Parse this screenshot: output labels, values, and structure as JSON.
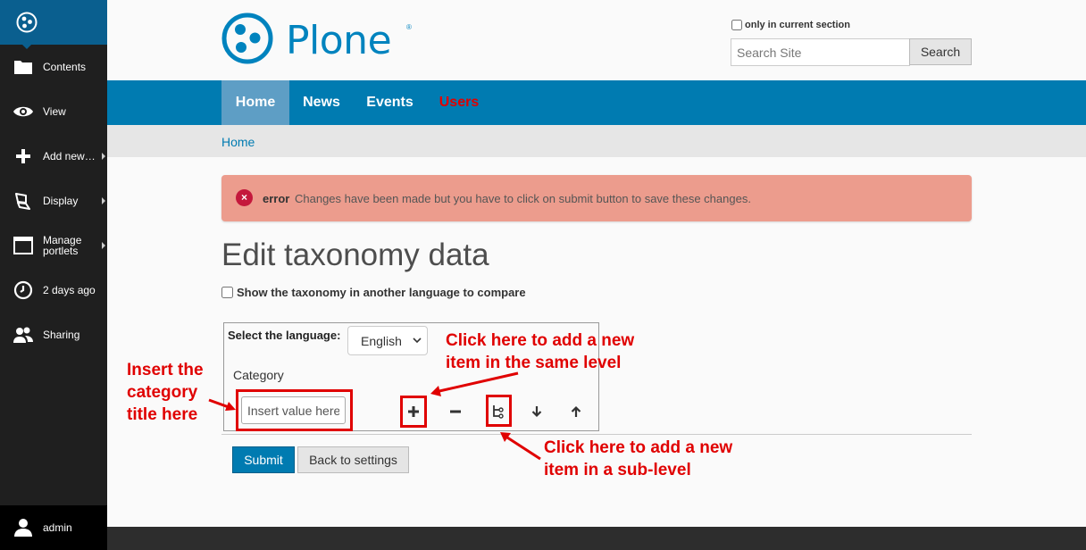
{
  "toolbar": {
    "items": [
      {
        "label": "Contents",
        "icon": "folder-icon"
      },
      {
        "label": "View",
        "icon": "eye-icon"
      },
      {
        "label": "Add new…",
        "icon": "plus-icon"
      },
      {
        "label": "Display",
        "icon": "display-icon"
      },
      {
        "label": "Manage portlets",
        "icon": "portlet-icon"
      },
      {
        "label": "2 days ago",
        "icon": "clock-icon"
      },
      {
        "label": "Sharing",
        "icon": "users-icon"
      }
    ],
    "user": {
      "label": "admin",
      "icon": "user-icon"
    }
  },
  "header": {
    "logo_text": "Plone",
    "logo_reg": "®",
    "search_scope_label": "only in current section",
    "search_placeholder": "Search Site",
    "search_button": "Search"
  },
  "nav": [
    {
      "label": "Home",
      "active": true
    },
    {
      "label": "News",
      "active": false
    },
    {
      "label": "Events",
      "active": false
    },
    {
      "label": "Users",
      "active": false
    }
  ],
  "breadcrumbs": [
    "Home"
  ],
  "alert": {
    "icon": "×",
    "type": "error",
    "message": "Changes have been made but you have to click on submit button to save these changes."
  },
  "page_title": "Edit taxonomy data",
  "compare_label": "Show the taxonomy in another language to compare",
  "editor": {
    "language_label": "Select the language:",
    "language_value": "English",
    "category_label": "Category",
    "value_placeholder": "Insert value here",
    "tools": [
      "add-icon",
      "remove-icon",
      "add-sublevel-icon",
      "move-down-icon",
      "move-up-icon"
    ]
  },
  "buttons": {
    "submit": "Submit",
    "back": "Back to settings"
  },
  "annotations": {
    "insert_title": [
      "Insert the",
      "category",
      "title here"
    ],
    "same_level": [
      "Click here to add a new",
      "item in the same level"
    ],
    "sub_level": [
      "Click here to add a new",
      "item in a sub-level"
    ]
  },
  "colors": {
    "brand": "#0083be",
    "nav_bg": "#007bb1",
    "nav_active": "#5e9ec5",
    "annotation": "#e00000",
    "alert_bg": "#ec9c8d",
    "users_link": "#e00000"
  }
}
